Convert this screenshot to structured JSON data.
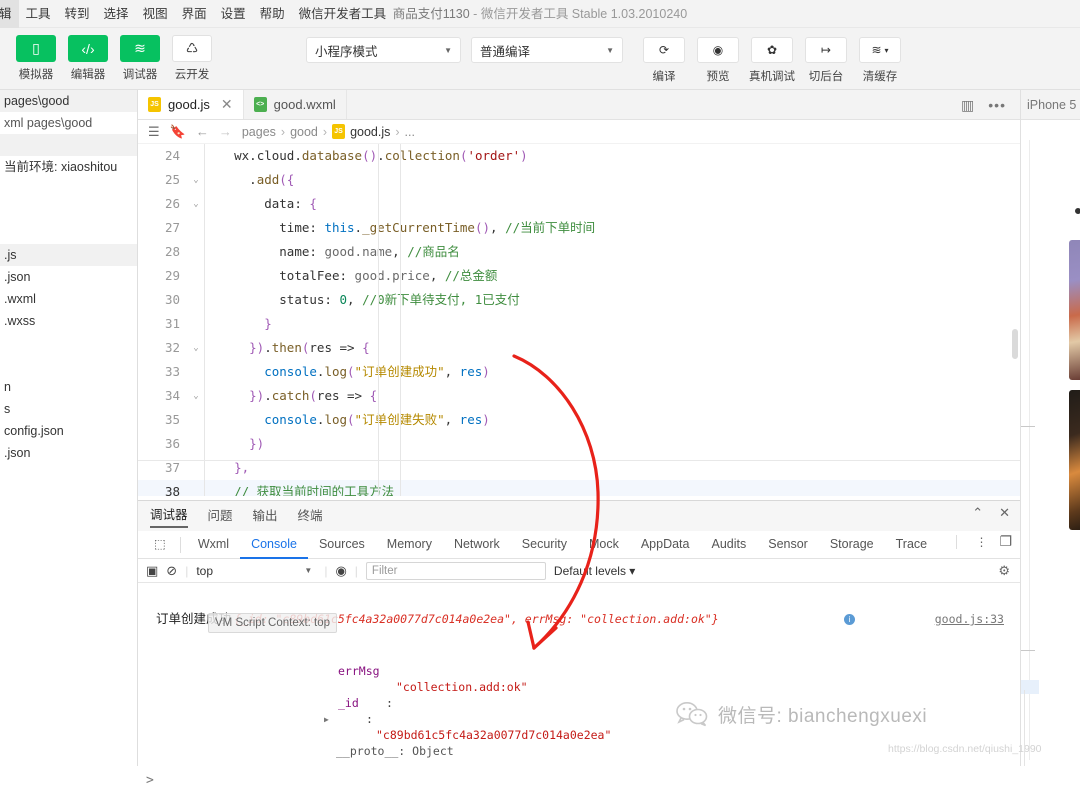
{
  "window": {
    "title_project": "商品支付1130",
    "title_sep": "-",
    "title_app": "微信开发者工具 Stable 1.03.2010240"
  },
  "menubar": {
    "items": [
      {
        "label": "辑",
        "name": "menu-edit-clipped"
      },
      {
        "label": "工具",
        "name": "menu-tools"
      },
      {
        "label": "转到",
        "name": "menu-goto"
      },
      {
        "label": "选择",
        "name": "menu-select"
      },
      {
        "label": "视图",
        "name": "menu-view"
      },
      {
        "label": "界面",
        "name": "menu-interface"
      },
      {
        "label": "设置",
        "name": "menu-settings"
      },
      {
        "label": "帮助",
        "name": "menu-help"
      },
      {
        "label": "微信开发者工具",
        "name": "menu-devtools"
      }
    ]
  },
  "toolbar": {
    "mode_buttons": [
      {
        "label": "模拟器",
        "icon": "phone-icon",
        "style": "green"
      },
      {
        "label": "编辑器",
        "icon": "code-icon",
        "style": "green"
      },
      {
        "label": "调试器",
        "icon": "debug-icon",
        "style": "green"
      },
      {
        "label": "云开发",
        "icon": "cloud-icon",
        "style": "white"
      }
    ],
    "mode_select": {
      "value": "小程序模式",
      "name": "miniprogram-mode-select"
    },
    "compile_select": {
      "value": "普通编译",
      "name": "compile-mode-select"
    },
    "actions": [
      {
        "label": "编译",
        "icon": "refresh-icon"
      },
      {
        "label": "预览",
        "icon": "eye-icon"
      },
      {
        "label": "真机调试",
        "icon": "bug-icon"
      },
      {
        "label": "切后台",
        "icon": "background-icon"
      },
      {
        "label": "清缓存",
        "icon": "layers-icon"
      }
    ]
  },
  "filetree": {
    "rows": [
      {
        "text": "pages\\good",
        "kind": "head"
      },
      {
        "text": "xml   pages\\good",
        "kind": "sub"
      },
      {
        "text": "",
        "kind": "head"
      },
      {
        "text": "当前环境: xiaoshitou",
        "kind": "plain"
      },
      {
        "text": "",
        "kind": "plain"
      },
      {
        "text": "",
        "kind": "plain"
      },
      {
        "text": "",
        "kind": "plain"
      },
      {
        "text": ".js",
        "kind": "head"
      },
      {
        "text": ".json",
        "kind": "plain"
      },
      {
        "text": ".wxml",
        "kind": "plain"
      },
      {
        "text": ".wxss",
        "kind": "plain"
      },
      {
        "text": "",
        "kind": "plain"
      },
      {
        "text": "",
        "kind": "plain"
      },
      {
        "text": "n",
        "kind": "plain"
      },
      {
        "text": "s",
        "kind": "plain"
      },
      {
        "text": "config.json",
        "kind": "plain"
      },
      {
        "text": ".json",
        "kind": "plain"
      }
    ]
  },
  "editor_tabs": {
    "tabs": [
      {
        "label": "good.js",
        "icon": "js-file-icon",
        "active": true,
        "closable": true
      },
      {
        "label": "good.wxml",
        "icon": "wxml-file-icon",
        "active": false,
        "closable": false
      }
    ],
    "split_icon": "split-editor-icon",
    "more_icon": "more-actions-icon"
  },
  "breadcrumb": {
    "list_icon": "outline-icon",
    "bookmark_icon": "bookmark-icon",
    "back_icon": "arrow-left-icon",
    "forward_icon": "arrow-right-icon",
    "parts": [
      "pages",
      "good",
      "good.js",
      "..."
    ],
    "file_icon": "js-file-icon"
  },
  "code": {
    "lines": [
      {
        "n": "24",
        "fold": "",
        "hl": false,
        "indent": 2,
        "tokens": [
          {
            "t": "wx",
            "c": "plain"
          },
          {
            "t": ".",
            "c": "plain"
          },
          {
            "t": "cloud",
            "c": "plain"
          },
          {
            "t": ".",
            "c": "plain"
          },
          {
            "t": "database",
            "c": "fn"
          },
          {
            "t": "()",
            "c": "pl"
          },
          {
            "t": ".",
            "c": "plain"
          },
          {
            "t": "collection",
            "c": "fn"
          },
          {
            "t": "(",
            "c": "pl"
          },
          {
            "t": "'order'",
            "c": "str"
          },
          {
            "t": ")",
            "c": "pl"
          }
        ]
      },
      {
        "n": "25",
        "fold": "v",
        "hl": false,
        "indent": 3,
        "tokens": [
          {
            "t": ".",
            "c": "plain"
          },
          {
            "t": "add",
            "c": "fn"
          },
          {
            "t": "({",
            "c": "pl"
          }
        ]
      },
      {
        "n": "26",
        "fold": "v",
        "hl": false,
        "indent": 4,
        "tokens": [
          {
            "t": "data",
            "c": "plain"
          },
          {
            "t": ": ",
            "c": "plain"
          },
          {
            "t": "{",
            "c": "pl"
          }
        ]
      },
      {
        "n": "27",
        "fold": "",
        "hl": false,
        "indent": 5,
        "tokens": [
          {
            "t": "time",
            "c": "plain"
          },
          {
            "t": ": ",
            "c": "plain"
          },
          {
            "t": "this",
            "c": "this"
          },
          {
            "t": ".",
            "c": "plain"
          },
          {
            "t": "_getCurrentTime",
            "c": "fn"
          },
          {
            "t": "()",
            "c": "pl"
          },
          {
            "t": ", ",
            "c": "plain"
          },
          {
            "t": "//当前下单时间",
            "c": "cmt"
          }
        ]
      },
      {
        "n": "28",
        "fold": "",
        "hl": false,
        "indent": 5,
        "tokens": [
          {
            "t": "name",
            "c": "plain"
          },
          {
            "t": ": ",
            "c": "plain"
          },
          {
            "t": "good.name",
            "c": "prop"
          },
          {
            "t": ", ",
            "c": "plain"
          },
          {
            "t": "//商品名",
            "c": "cmt"
          }
        ]
      },
      {
        "n": "29",
        "fold": "",
        "hl": false,
        "indent": 5,
        "tokens": [
          {
            "t": "totalFee",
            "c": "plain"
          },
          {
            "t": ": ",
            "c": "plain"
          },
          {
            "t": "good.price",
            "c": "prop"
          },
          {
            "t": ", ",
            "c": "plain"
          },
          {
            "t": "//总金额",
            "c": "cmt"
          }
        ]
      },
      {
        "n": "30",
        "fold": "",
        "hl": false,
        "indent": 5,
        "tokens": [
          {
            "t": "status",
            "c": "plain"
          },
          {
            "t": ": ",
            "c": "plain"
          },
          {
            "t": "0",
            "c": "num"
          },
          {
            "t": ", ",
            "c": "plain"
          },
          {
            "t": "//0新下单待支付, 1已支付",
            "c": "cmt"
          }
        ]
      },
      {
        "n": "31",
        "fold": "",
        "hl": false,
        "indent": 4,
        "tokens": [
          {
            "t": "}",
            "c": "pl"
          }
        ]
      },
      {
        "n": "32",
        "fold": "v",
        "hl": false,
        "indent": 3,
        "tokens": [
          {
            "t": "})",
            "c": "pl"
          },
          {
            "t": ".",
            "c": "plain"
          },
          {
            "t": "then",
            "c": "fn"
          },
          {
            "t": "(",
            "c": "pl"
          },
          {
            "t": "res",
            "c": "plain"
          },
          {
            "t": " => ",
            "c": "plain"
          },
          {
            "t": "{",
            "c": "pl"
          }
        ]
      },
      {
        "n": "33",
        "fold": "",
        "hl": false,
        "indent": 4,
        "tokens": [
          {
            "t": "console",
            "c": "this"
          },
          {
            "t": ".",
            "c": "plain"
          },
          {
            "t": "log",
            "c": "fn"
          },
          {
            "t": "(",
            "c": "pl"
          },
          {
            "t": "\"订单创建成功\"",
            "c": "pr"
          },
          {
            "t": ", ",
            "c": "plain"
          },
          {
            "t": "res",
            "c": "this"
          },
          {
            "t": ")",
            "c": "pl"
          }
        ]
      },
      {
        "n": "34",
        "fold": "v",
        "hl": false,
        "indent": 3,
        "tokens": [
          {
            "t": "})",
            "c": "pl"
          },
          {
            "t": ".",
            "c": "plain"
          },
          {
            "t": "catch",
            "c": "fn"
          },
          {
            "t": "(",
            "c": "pl"
          },
          {
            "t": "res",
            "c": "plain"
          },
          {
            "t": " => ",
            "c": "plain"
          },
          {
            "t": "{",
            "c": "pl"
          }
        ]
      },
      {
        "n": "35",
        "fold": "",
        "hl": false,
        "indent": 4,
        "tokens": [
          {
            "t": "console",
            "c": "this"
          },
          {
            "t": ".",
            "c": "plain"
          },
          {
            "t": "log",
            "c": "fn"
          },
          {
            "t": "(",
            "c": "pl"
          },
          {
            "t": "\"订单创建失败\"",
            "c": "pr"
          },
          {
            "t": ", ",
            "c": "plain"
          },
          {
            "t": "res",
            "c": "this"
          },
          {
            "t": ")",
            "c": "pl"
          }
        ]
      },
      {
        "n": "36",
        "fold": "",
        "hl": false,
        "indent": 3,
        "tokens": [
          {
            "t": "})",
            "c": "pl"
          }
        ]
      },
      {
        "n": "37",
        "fold": "",
        "hl": false,
        "indent": 2,
        "tokens": [
          {
            "t": "},",
            "c": "pl"
          }
        ]
      },
      {
        "n": "38",
        "fold": "",
        "hl": true,
        "indent": 2,
        "tokens": [
          {
            "t": "// 获取当前时间的工具方法",
            "c": "cmt"
          }
        ]
      }
    ]
  },
  "console_panel": {
    "panel_tabs": [
      {
        "label": "调试器",
        "active": true
      },
      {
        "label": "问题",
        "active": false
      },
      {
        "label": "输出",
        "active": false
      },
      {
        "label": "终端",
        "active": false
      }
    ],
    "collapse_icon": "chevron-up-icon",
    "close_icon": "close-icon",
    "devtools_tabs": [
      {
        "label": "Wxml",
        "active": false
      },
      {
        "label": "Console",
        "active": true
      },
      {
        "label": "Sources",
        "active": false
      },
      {
        "label": "Memory",
        "active": false
      },
      {
        "label": "Network",
        "active": false
      },
      {
        "label": "Security",
        "active": false
      },
      {
        "label": "Mock",
        "active": false
      },
      {
        "label": "AppData",
        "active": false
      },
      {
        "label": "Audits",
        "active": false
      },
      {
        "label": "Sensor",
        "active": false
      },
      {
        "label": "Storage",
        "active": false
      },
      {
        "label": "Trace",
        "active": false
      }
    ],
    "inspect_icon": "inspect-element-icon",
    "dots_icon": "kebab-menu-icon",
    "dock_icon": "dock-panel-icon",
    "controls": {
      "execute_icon": "execute-snippet-icon",
      "clear_icon": "clear-console-icon",
      "context": "top",
      "eye_icon": "live-expression-icon",
      "filter_placeholder": "Filter",
      "levels": "Default levels",
      "gear_icon": "console-settings-icon"
    },
    "tooltip": "VM Script Context: top",
    "output": {
      "message": "订单创建成功",
      "object_text": "{_id: \"c89bd61c5fc4a32a0077d7c014a0e2ea\", errMsg: \"collection.add:ok\"}",
      "info_badge": "i",
      "source": "good.js:33",
      "expanded": [
        {
          "key": "errMsg",
          "value": "\"collection.add:ok\""
        },
        {
          "key": "_id",
          "value": "\"c89bd61c5fc4a32a0077d7c014a0e2ea\""
        }
      ],
      "proto_label": "__proto__: Object",
      "prompt": ">"
    }
  },
  "simulator": {
    "device_label": "iPhone 5"
  },
  "watermark": {
    "logo_icon": "wechat-logo-icon",
    "text": "微信号: bianchengxuexi",
    "url": "https://blog.csdn.net/qiushi_1990"
  },
  "colors": {
    "accent_green": "#07c160",
    "devtools_blue": "#1a73e8",
    "annotation_red": "#e8221a"
  }
}
